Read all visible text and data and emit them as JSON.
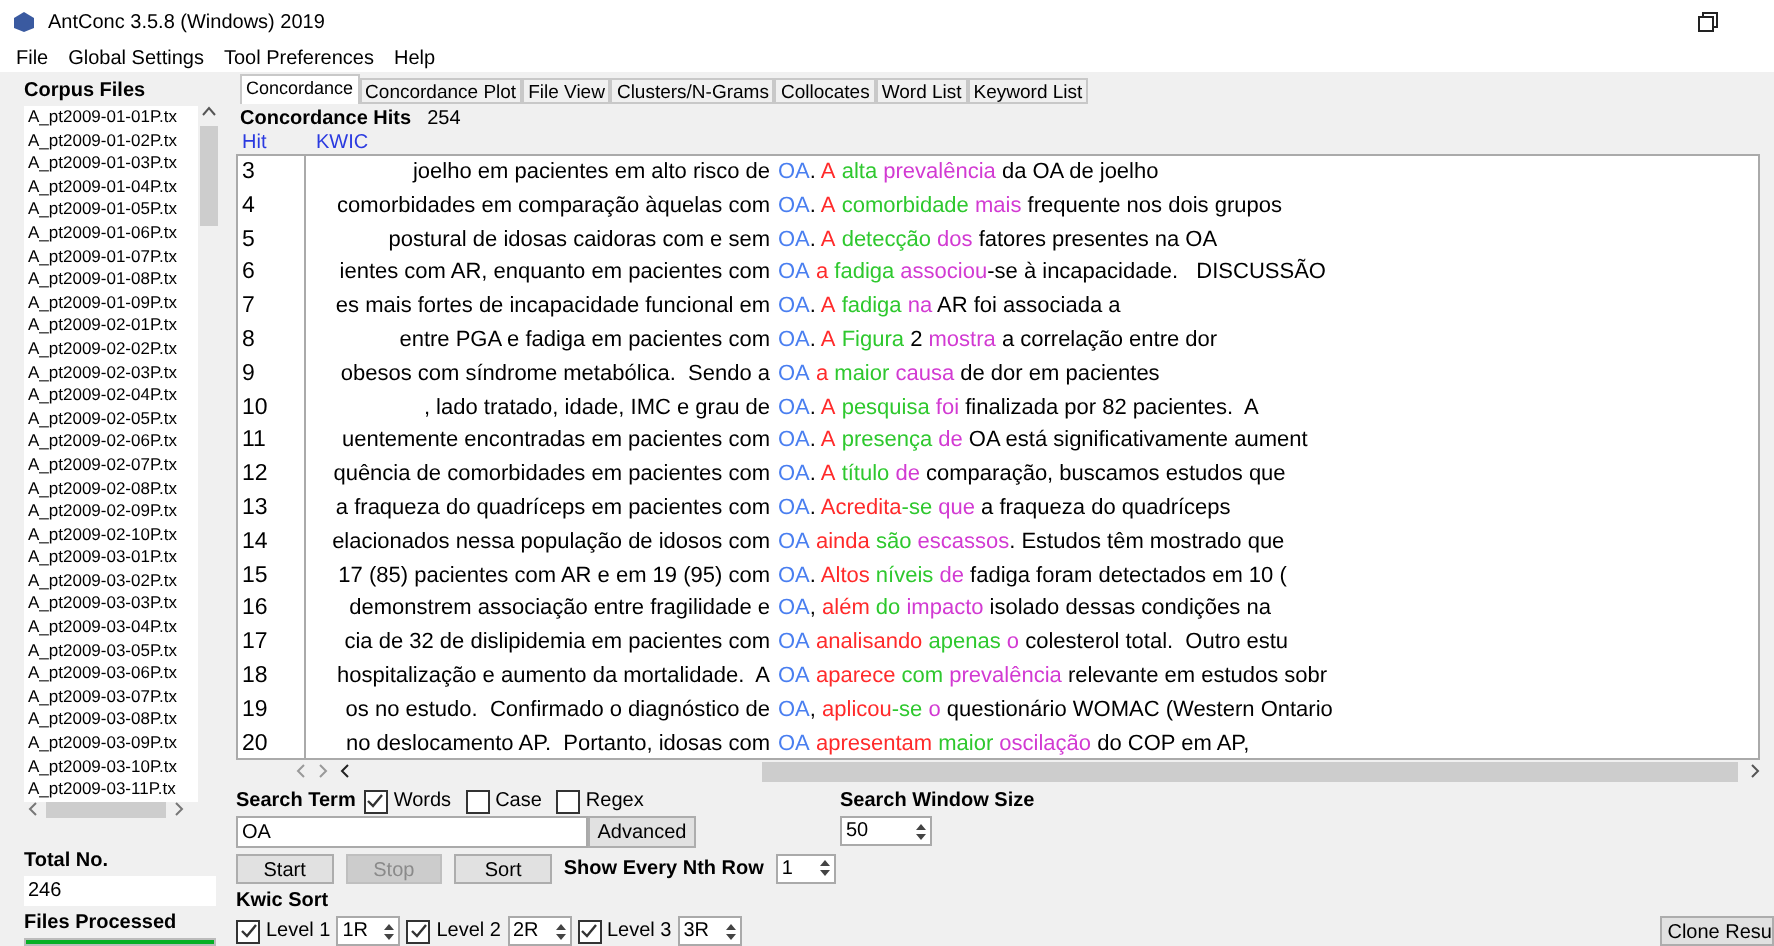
{
  "window": {
    "title": "AntConc 3.5.8 (Windows) 2019"
  },
  "menu": [
    "File",
    "Global Settings",
    "Tool Preferences",
    "Help"
  ],
  "corpus": {
    "title": "Corpus Files",
    "files": [
      "A_pt2009-01-01P.tx",
      "A_pt2009-01-02P.tx",
      "A_pt2009-01-03P.tx",
      "A_pt2009-01-04P.tx",
      "A_pt2009-01-05P.tx",
      "A_pt2009-01-06P.tx",
      "A_pt2009-01-07P.tx",
      "A_pt2009-01-08P.tx",
      "A_pt2009-01-09P.tx",
      "A_pt2009-02-01P.tx",
      "A_pt2009-02-02P.tx",
      "A_pt2009-02-03P.tx",
      "A_pt2009-02-04P.tx",
      "A_pt2009-02-05P.tx",
      "A_pt2009-02-06P.tx",
      "A_pt2009-02-07P.tx",
      "A_pt2009-02-08P.tx",
      "A_pt2009-02-09P.tx",
      "A_pt2009-02-10P.tx",
      "A_pt2009-03-01P.tx",
      "A_pt2009-03-02P.tx",
      "A_pt2009-03-03P.tx",
      "A_pt2009-03-04P.tx",
      "A_pt2009-03-05P.tx",
      "A_pt2009-03-06P.tx",
      "A_pt2009-03-07P.tx",
      "A_pt2009-03-08P.tx",
      "A_pt2009-03-09P.tx",
      "A_pt2009-03-10P.tx",
      "A_pt2009-03-11P.tx"
    ],
    "total_label": "Total No.",
    "total": "246",
    "processed_label": "Files Processed",
    "progress": {
      "level": 1
    }
  },
  "tabs": [
    {
      "label": "Concordance",
      "selected": true
    },
    {
      "label": "Concordance Plot",
      "selected": false
    },
    {
      "label": "File View",
      "selected": false
    },
    {
      "label": "Clusters/N-Grams",
      "selected": false
    },
    {
      "label": "Collocates",
      "selected": false
    },
    {
      "label": "Word List",
      "selected": false
    },
    {
      "label": "Keyword List",
      "selected": false
    }
  ],
  "hits_label": "Concordance Hits",
  "hits": "254",
  "columns": [
    "Hit",
    "KWIC"
  ],
  "rows": [
    {
      "hit": "3",
      "left": "joelho em pacientes em alto risco de",
      "key": "OA",
      "right": [
        {
          "text": "."
        },
        {
          "text": " A",
          "color": "#ff2a2a"
        },
        {
          "text": " alta",
          "color": "#2ec82e"
        },
        {
          "text": " prevalência",
          "color": "#d23ad2"
        },
        {
          "text": " da OA de joelho"
        }
      ]
    },
    {
      "hit": "4",
      "left": "comorbidades em comparação àquelas com",
      "key": "OA",
      "right": [
        {
          "text": "."
        },
        {
          "text": " A",
          "color": "#ff2a2a"
        },
        {
          "text": " comorbidade",
          "color": "#2ec82e"
        },
        {
          "text": " mais",
          "color": "#d23ad2"
        },
        {
          "text": " frequente nos dois grupos"
        }
      ]
    },
    {
      "hit": "5",
      "left": "postural de idosas caidoras com e sem",
      "key": "OA",
      "right": [
        {
          "text": "."
        },
        {
          "text": " A",
          "color": "#ff2a2a"
        },
        {
          "text": " detecção",
          "color": "#2ec82e"
        },
        {
          "text": " dos",
          "color": "#d23ad2"
        },
        {
          "text": " fatores presentes na OA"
        }
      ]
    },
    {
      "hit": "6",
      "left": "ientes com AR, enquanto em pacientes com",
      "key": "OA",
      "right": [
        {
          "text": " a",
          "color": "#ff2a2a"
        },
        {
          "text": " fadiga",
          "color": "#2ec82e"
        },
        {
          "text": " associou",
          "color": "#d23ad2"
        },
        {
          "text": "-se à incapacidade.   DISCUSSÃO"
        }
      ]
    },
    {
      "hit": "7",
      "left": "es mais fortes de incapacidade funcional em",
      "key": "OA",
      "right": [
        {
          "text": "."
        },
        {
          "text": " A",
          "color": "#ff2a2a"
        },
        {
          "text": " fadiga",
          "color": "#2ec82e"
        },
        {
          "text": " na",
          "color": "#d23ad2"
        },
        {
          "text": " AR foi associada a"
        }
      ]
    },
    {
      "hit": "8",
      "left": "entre PGA e fadiga em pacientes com",
      "key": "OA",
      "right": [
        {
          "text": "."
        },
        {
          "text": " A",
          "color": "#ff2a2a"
        },
        {
          "text": " Figura",
          "color": "#2ec82e"
        },
        {
          "text": " 2"
        },
        {
          "text": " mostra",
          "color": "#d23ad2"
        },
        {
          "text": " a correlação entre dor"
        }
      ]
    },
    {
      "hit": "9",
      "left": "obesos com síndrome metabólica.  Sendo a",
      "key": "OA",
      "right": [
        {
          "text": " a",
          "color": "#ff2a2a"
        },
        {
          "text": " maior",
          "color": "#2ec82e"
        },
        {
          "text": " causa",
          "color": "#d23ad2"
        },
        {
          "text": " de dor em pacientes"
        }
      ]
    },
    {
      "hit": "10",
      "left": ", lado tratado, idade, IMC e grau de",
      "key": "OA",
      "right": [
        {
          "text": "."
        },
        {
          "text": " A",
          "color": "#ff2a2a"
        },
        {
          "text": " pesquisa",
          "color": "#2ec82e"
        },
        {
          "text": " foi",
          "color": "#d23ad2"
        },
        {
          "text": " finalizada por 82 pacientes.  A"
        }
      ]
    },
    {
      "hit": "11",
      "left": "uentemente encontradas em pacientes com",
      "key": "OA",
      "right": [
        {
          "text": "."
        },
        {
          "text": " A",
          "color": "#ff2a2a"
        },
        {
          "text": " presença",
          "color": "#2ec82e"
        },
        {
          "text": " de",
          "color": "#d23ad2"
        },
        {
          "text": " OA está significativamente aument"
        }
      ]
    },
    {
      "hit": "12",
      "left": "quência de comorbidades em pacientes com",
      "key": "OA",
      "right": [
        {
          "text": "."
        },
        {
          "text": " A",
          "color": "#ff2a2a"
        },
        {
          "text": " título",
          "color": "#2ec82e"
        },
        {
          "text": " de",
          "color": "#d23ad2"
        },
        {
          "text": " comparação, buscamos estudos que"
        }
      ]
    },
    {
      "hit": "13",
      "left": "a fraqueza do quadríceps em pacientes com",
      "key": "OA",
      "right": [
        {
          "text": "."
        },
        {
          "text": " Acredita",
          "color": "#ff2a2a"
        },
        {
          "text": "-se",
          "color": "#2ec82e"
        },
        {
          "text": " que",
          "color": "#d23ad2"
        },
        {
          "text": " a fraqueza do quadríceps"
        }
      ]
    },
    {
      "hit": "14",
      "left": "elacionados nessa população de idosos com",
      "key": "OA",
      "right": [
        {
          "text": " ainda",
          "color": "#ff2a2a"
        },
        {
          "text": " são",
          "color": "#2ec82e"
        },
        {
          "text": " escassos",
          "color": "#d23ad2"
        },
        {
          "text": ". Estudos têm mostrado que"
        }
      ]
    },
    {
      "hit": "15",
      "left": "17 (85) pacientes com AR e em 19 (95) com",
      "key": "OA",
      "right": [
        {
          "text": "."
        },
        {
          "text": " Altos",
          "color": "#ff2a2a"
        },
        {
          "text": " níveis",
          "color": "#2ec82e"
        },
        {
          "text": " de",
          "color": "#d23ad2"
        },
        {
          "text": " fadiga foram detectados em 10 ("
        }
      ]
    },
    {
      "hit": "16",
      "left": "demonstrem associação entre fragilidade e",
      "key": "OA",
      "right": [
        {
          "text": ","
        },
        {
          "text": " além",
          "color": "#ff2a2a"
        },
        {
          "text": " do",
          "color": "#2ec82e"
        },
        {
          "text": " impacto",
          "color": "#d23ad2"
        },
        {
          "text": " isolado dessas condições na"
        }
      ]
    },
    {
      "hit": "17",
      "left": "cia de 32 de dislipidemia em pacientes com",
      "key": "OA",
      "right": [
        {
          "text": " analisando",
          "color": "#ff2a2a"
        },
        {
          "text": " apenas",
          "color": "#2ec82e"
        },
        {
          "text": " o",
          "color": "#d23ad2"
        },
        {
          "text": " colesterol total.  Outro estu"
        }
      ]
    },
    {
      "hit": "18",
      "left": "hospitalização e aumento da mortalidade.  A",
      "key": "OA",
      "right": [
        {
          "text": " aparece",
          "color": "#ff2a2a"
        },
        {
          "text": " com",
          "color": "#2ec82e"
        },
        {
          "text": " prevalência",
          "color": "#d23ad2"
        },
        {
          "text": " relevante em estudos sobr"
        }
      ]
    },
    {
      "hit": "19",
      "left": "os no estudo.  Confirmado o diagnóstico de",
      "key": "OA",
      "right": [
        {
          "text": ","
        },
        {
          "text": " aplicou",
          "color": "#ff2a2a"
        },
        {
          "text": "-se",
          "color": "#2ec82e"
        },
        {
          "text": " o",
          "color": "#d23ad2"
        },
        {
          "text": " questionário WOMAC (Western Ontario"
        }
      ]
    },
    {
      "hit": "20",
      "left": "no deslocamento AP.  Portanto, idosas com",
      "key": "OA",
      "right": [
        {
          "text": " apresentam",
          "color": "#ff2a2a"
        },
        {
          "text": " maior",
          "color": "#2ec82e"
        },
        {
          "text": " oscilação",
          "color": "#d23ad2"
        },
        {
          "text": " do COP em AP,"
        }
      ]
    }
  ],
  "search": {
    "label": "Search Term",
    "options": [
      {
        "label": "Words",
        "checked": true
      },
      {
        "label": "Case",
        "checked": false
      },
      {
        "label": "Regex",
        "checked": false
      }
    ],
    "value": "OA",
    "advanced": "Advanced"
  },
  "buttons": [
    {
      "label": "Start",
      "disabled": false
    },
    {
      "label": "Stop",
      "disabled": true
    },
    {
      "label": "Sort",
      "disabled": false
    }
  ],
  "nth_label": "Show Every Nth Row",
  "nth": "1",
  "window_size_label": "Search Window Size",
  "window_size": "50",
  "kwic_label": "Kwic Sort",
  "levels": [
    {
      "label": "Level 1",
      "checked": true,
      "value": "1R"
    },
    {
      "label": "Level 2",
      "checked": true,
      "value": "2R"
    },
    {
      "label": "Level 3",
      "checked": true,
      "value": "3R"
    }
  ],
  "clone": "Clone Resu"
}
